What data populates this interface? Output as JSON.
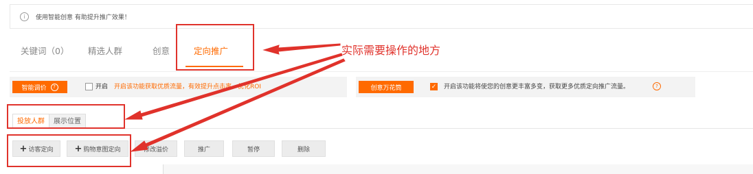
{
  "tip": {
    "icon": "info-icon",
    "text": "使用智能创意 有助提升推广效果！"
  },
  "tabs": [
    {
      "label": "关键词（0）"
    },
    {
      "label": "精选人群"
    },
    {
      "label": "创意"
    },
    {
      "label": "定向推广"
    }
  ],
  "smart_bid": {
    "badge": "智能调价",
    "help_icon": "help-icon",
    "checkbox_label": "开启",
    "checked": false,
    "hint": "开启该功能获取优质流量，有效提升点击率，优化ROI"
  },
  "creative": {
    "badge": "创意万花筒",
    "checked": true,
    "text": "开启该功能将使您的创意更丰富多变，获取更多优质定向推广流量。",
    "help_icon": "help-icon"
  },
  "subtabs": [
    {
      "label": "投放人群"
    },
    {
      "label": "展示位置"
    }
  ],
  "actions": {
    "visitor": "访客定向",
    "shopping": "购物意图定向",
    "modify": "修改溢价",
    "promote": "推广",
    "pause": "暂停",
    "delete": "删除"
  },
  "annotation": {
    "text": "实际需要操作的地方"
  },
  "colors": {
    "accent": "#ff6a00",
    "annotation_red": "#e0322b"
  }
}
